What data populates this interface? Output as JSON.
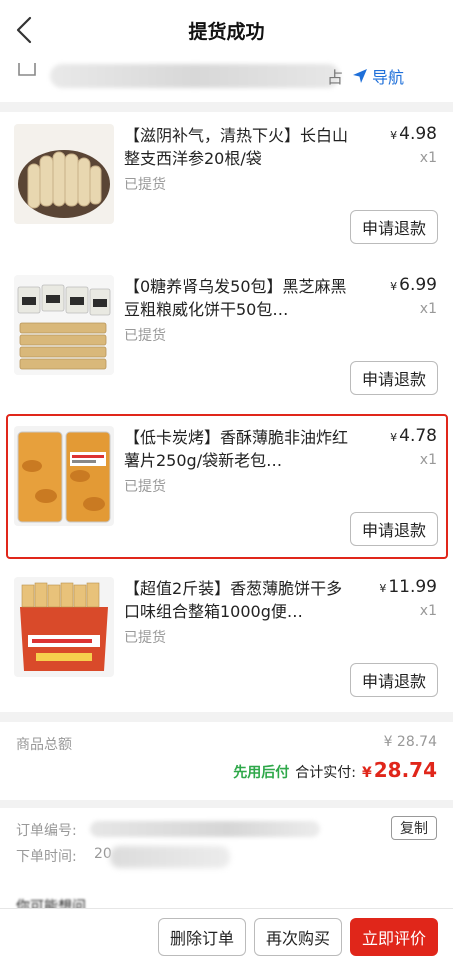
{
  "header": {
    "title": "提货成功",
    "back_icon": "chevron-left-icon"
  },
  "address": {
    "tail_char": "占",
    "nav_label": "导航",
    "nav_icon": "location-arrow-icon"
  },
  "items": [
    {
      "name": "【滋阴补气，清热下火】长白山整支西洋参20根/袋",
      "status": "已提货",
      "currency": "¥",
      "price": "4.98",
      "qty": "x1",
      "refund_label": "申请退款"
    },
    {
      "name": "【0糖养肾乌发50包】黑芝麻黑豆粗粮威化饼干50包…",
      "status": "已提货",
      "currency": "¥",
      "price": "6.99",
      "qty": "x1",
      "refund_label": "申请退款"
    },
    {
      "name": "【低卡炭烤】香酥薄脆非油炸红薯片250g/袋新老包…",
      "status": "已提货",
      "currency": "¥",
      "price": "4.78",
      "qty": "x1",
      "refund_label": "申请退款"
    },
    {
      "name": "【超值2斤装】香葱薄脆饼干多口味组合整箱1000g便…",
      "status": "已提货",
      "currency": "¥",
      "price": "11.99",
      "qty": "x1",
      "refund_label": "申请退款"
    }
  ],
  "summary": {
    "total_label": "商品总额",
    "total_value": "¥ 28.74",
    "pay_later": "先用后付",
    "paid_label": "合计实付:",
    "paid_currency": "¥",
    "paid_amount": "28.74"
  },
  "order": {
    "number_label": "订单编号:",
    "copy_label": "复制",
    "time_label": "下单时间:",
    "time_value": "20"
  },
  "peek_text": "你可能想问",
  "actions": {
    "delete": "删除订单",
    "rebuy": "再次购买",
    "review": "立即评价"
  },
  "colors": {
    "accent": "#e0261a",
    "nav_blue": "#1e6fd9",
    "pay_later_green": "#2fa84a"
  }
}
